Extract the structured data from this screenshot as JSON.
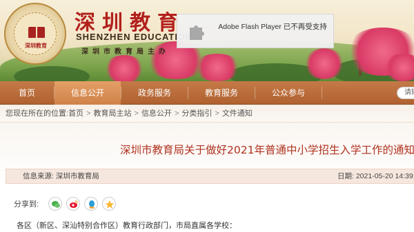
{
  "header": {
    "brand_cn": "深圳教育",
    "brand_en": "SHENZHEN EDUCATION",
    "brand_sub": "深圳市教育局主办",
    "seal_text": "深圳教育"
  },
  "flash_notice": {
    "message": "Adobe Flash Player 已不再受支持"
  },
  "nav": {
    "items": [
      {
        "label": "首页"
      },
      {
        "label": "信息公开",
        "active": true
      },
      {
        "label": "政务服务"
      },
      {
        "label": "教育服务"
      },
      {
        "label": "公众参与"
      }
    ],
    "search_placeholder": "请输"
  },
  "breadcrumb": {
    "prefix": "您现在所在的位置: ",
    "items": [
      "首页",
      "教育局主站",
      "信息公开",
      "分类指引",
      "文件通知"
    ],
    "separator": ">"
  },
  "article": {
    "title": "深圳市教育局关于做好2021年普通中小学招生入学工作的通知",
    "source": "信息来源:   深圳市教育局",
    "date": "日期:  2021-05-20 14:39:",
    "share_label": "分享到:",
    "share_icons": [
      "wechat-icon",
      "weibo-icon",
      "qq-icon",
      "qzone-icon"
    ],
    "body_first_line": "各区（新区、深汕特别合作区）教育行政部门，市局直属各学校："
  },
  "colors": {
    "nav_bg": "#b0612f",
    "nav_active": "#e4a067",
    "title_red": "#b0311f",
    "brand_red": "#b2201c"
  }
}
